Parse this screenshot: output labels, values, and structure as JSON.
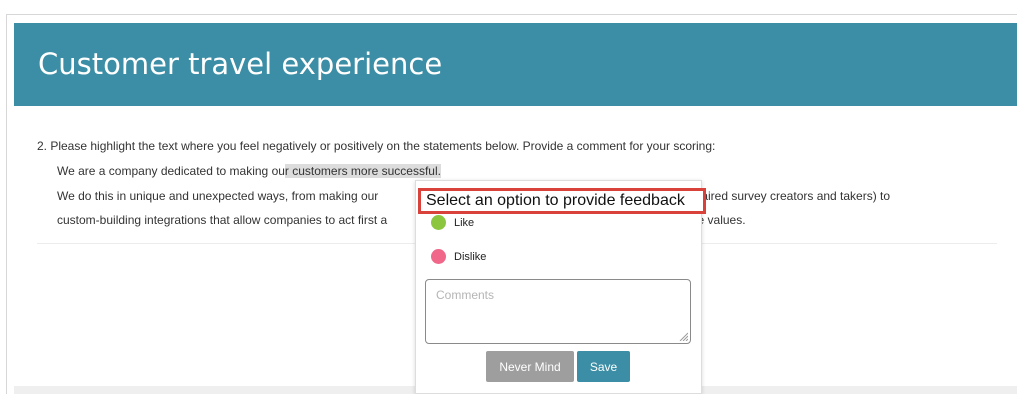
{
  "header": {
    "title": "Customer travel experience"
  },
  "question": {
    "text": "2. Please highlight the text where you feel negatively or positively on the statements below. Provide a comment for your scoring:"
  },
  "statements": {
    "line1_before": "We are a company dedicated to making ou",
    "line1_highlight": "r customers more successful.",
    "line2_before": "We do this in unique and unexpected ways, from making our ",
    "line2_after": "ally impaired survey creators and takers) to",
    "line3_before": "custom-building integrations that allow companies to act first a",
    "line3_after": "ee core values."
  },
  "popup": {
    "title": "Select an option to provide feedback",
    "options": [
      {
        "label": "Like",
        "color": "#8cc63f"
      },
      {
        "label": "Dislike",
        "color": "#f0678a"
      }
    ],
    "comments_placeholder": "Comments",
    "comments_value": "",
    "never_mind_label": "Never Mind",
    "save_label": "Save"
  },
  "colors": {
    "header_bg": "#3b8ea5",
    "save_bg": "#3b8ea5",
    "never_mind_bg": "#9e9e9e",
    "title_outline": "#d9413b",
    "highlight_bg": "#dcdcdc"
  },
  "icons": {
    "resize": "resize-grip-icon"
  }
}
